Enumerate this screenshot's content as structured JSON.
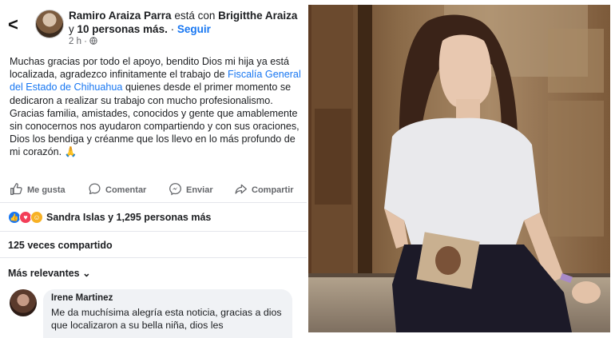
{
  "post": {
    "author": "Ramiro Araiza Parra",
    "with_text": "está con",
    "tagged": "Brigitthe Araiza",
    "and_text": "y",
    "others": "10 personas más.",
    "dot": "·",
    "follow_label": "Seguir",
    "time": "2 h ·",
    "body_part1": "Muchas gracias por todo el apoyo, bendito Dios mi hija ya está localizada, agradezco infinitamente el trabajo de",
    "body_link": "Fiscalía General del Estado de Chihuahua",
    "body_part2": " quienes desde el primer momento se dedicaron a realizar su trabajo con mucho profesionalismo.",
    "body_part3": "Gracias familia, amistades, conocidos y gente que amablemente sin conocernos nos ayudaron compartiendo y con sus oraciones, Dios los bendiga y créanme que los llevo en lo más profundo de mi corazón. 🙏"
  },
  "actions": {
    "like": "Me gusta",
    "comment": "Comentar",
    "send": "Enviar",
    "share": "Compartir"
  },
  "reactions": {
    "summary": "Sandra Islas y 1,295 personas más"
  },
  "shares_text": "125 veces compartido",
  "sort_label": "Más relevantes ⌄",
  "comment": {
    "name": "Irene Martinez",
    "text": "Me da muchísima alegría esta noticia,  gracias a dios que localizaron a su bella niña,  dios les"
  },
  "icons": [
    "back-arrow-icon",
    "globe-icon",
    "like-icon",
    "comment-icon",
    "messenger-icon",
    "share-icon",
    "like-reaction-icon",
    "love-reaction-icon",
    "care-reaction-icon"
  ],
  "colors": {
    "link": "#1877f2",
    "secondary": "#65676b"
  }
}
